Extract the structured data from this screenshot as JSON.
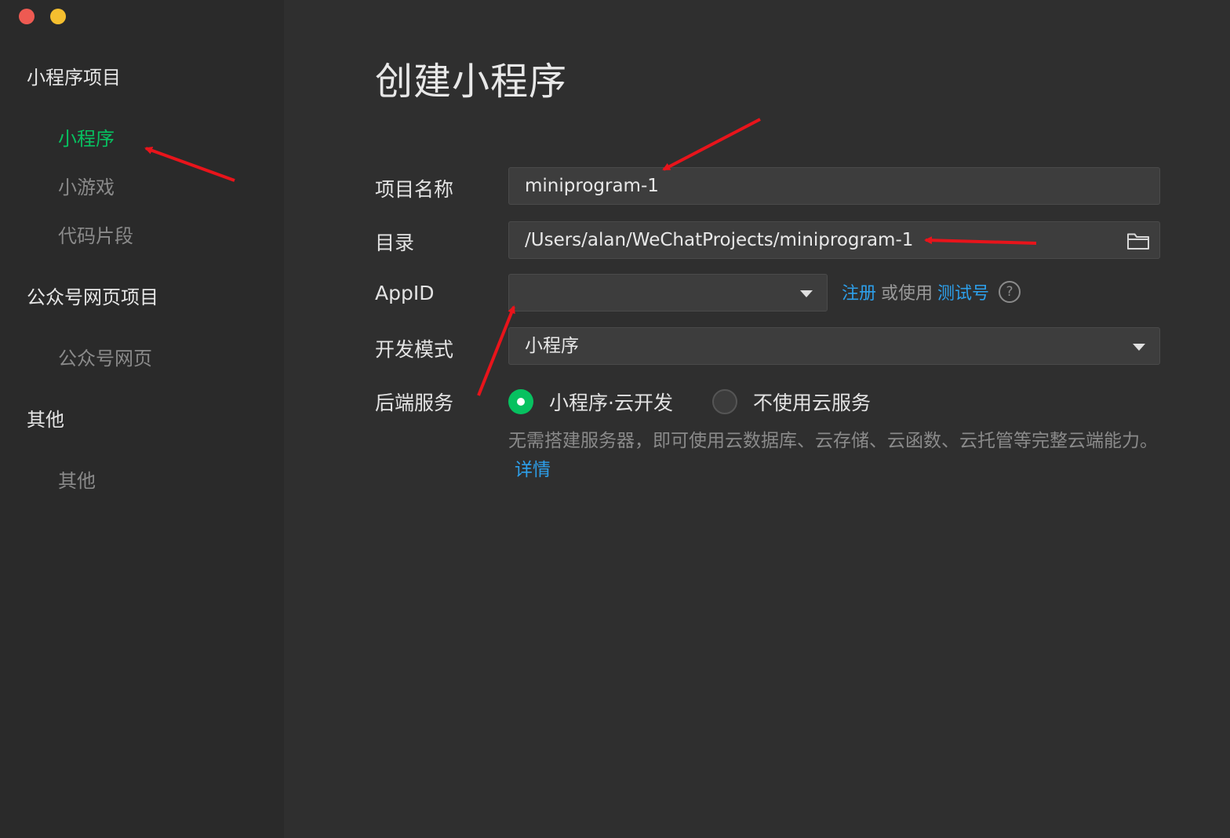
{
  "window": {
    "traffic_lights": [
      "close",
      "minimize"
    ]
  },
  "sidebar": {
    "groups": [
      {
        "title": "小程序项目",
        "items": [
          {
            "label": "小程序",
            "active": true
          },
          {
            "label": "小游戏",
            "active": false
          },
          {
            "label": "代码片段",
            "active": false
          }
        ]
      },
      {
        "title": "公众号网页项目",
        "items": [
          {
            "label": "公众号网页",
            "active": false
          }
        ]
      },
      {
        "title": "其他",
        "items": [
          {
            "label": "其他",
            "active": false
          }
        ]
      }
    ]
  },
  "main": {
    "title": "创建小程序",
    "form": {
      "project_name": {
        "label": "项目名称",
        "value": "miniprogram-1"
      },
      "directory": {
        "label": "目录",
        "value": "/Users/alan/WeChatProjects/miniprogram-1",
        "icon": "folder-icon"
      },
      "appid": {
        "label": "AppID",
        "value": "",
        "register_link": "注册",
        "or_use_text": "或使用",
        "test_account_link": "测试号",
        "help_icon": "?"
      },
      "dev_mode": {
        "label": "开发模式",
        "value": "小程序"
      },
      "backend": {
        "label": "后端服务",
        "options": [
          {
            "label": "小程序·云开发",
            "checked": true
          },
          {
            "label": "不使用云服务",
            "checked": false
          }
        ],
        "description": "无需搭建服务器，即可使用云数据库、云存储、云函数、云托管等完整云端能力。",
        "details_link": "详情"
      }
    }
  },
  "colors": {
    "accent_green": "#07c160",
    "link_blue": "#2d9fea",
    "annotation_arrow": "#e8141b",
    "sidebar_bg": "#2a2a2a",
    "main_bg": "#2f2f2f"
  }
}
